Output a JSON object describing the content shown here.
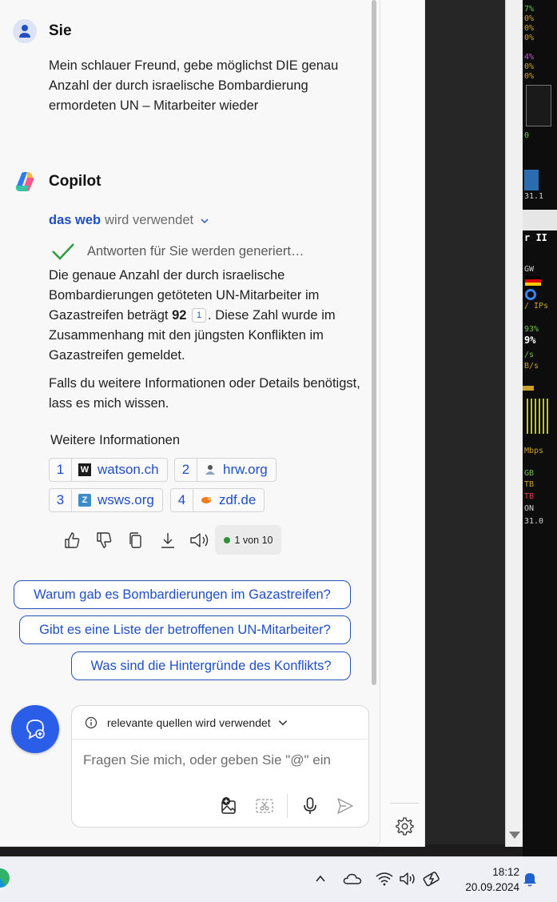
{
  "user": {
    "name": "Sie",
    "message": "Mein schlauer Freund, gebe möglichst DIE genau Anzahl der durch israelische Bombardierung ermordeten UN – Mitarbeiter wieder"
  },
  "copilot": {
    "name": "Copilot",
    "web_link": "das web",
    "web_suffix": "wird verwendet",
    "generating": "Antworten für Sie werden generiert…",
    "answer": {
      "before_number": "Die genaue Anzahl der durch israelische Bombardierungen getöteten UN-Mitarbeiter im Gazastreifen beträgt ",
      "number": "92",
      "citation": "1",
      "after_number": ". Diese Zahl wurde im Zusammenhang mit den jüngsten Konflikten im Gazastreifen gemeldet."
    },
    "followup": "Falls du weitere Informationen oder Details benötigst, lass es mich wissen.",
    "more_info_title": "Weitere Informationen",
    "sources": [
      {
        "num": "1",
        "label": "watson.ch",
        "fav": "W"
      },
      {
        "num": "2",
        "label": "hrw.org",
        "fav": ""
      },
      {
        "num": "3",
        "label": "wsws.org",
        "fav": "Z"
      },
      {
        "num": "4",
        "label": "zdf.de",
        "fav": ""
      }
    ],
    "page_indicator": "1 von 10"
  },
  "suggestions": [
    "Warum gab es Bombardierungen im Gazastreifen?",
    "Gibt es eine Liste der betroffenen UN-Mitarbeiter?",
    "Was sind die Hintergründe des Konflikts?"
  ],
  "composer": {
    "source_mode": "relevante quellen wird verwendet",
    "placeholder": "Fragen Sie mich, oder geben Sie \"@\" ein"
  },
  "widget_text": [
    "7%",
    "0%",
    "0%",
    "0%",
    "4%",
    "0%",
    "0%",
    "0",
    "31.1",
    "r II",
    "GW",
    "/ IPs",
    "93%",
    "9%",
    "/s",
    "B/s",
    "Mbps",
    "GB",
    "TB",
    "TB",
    "ON",
    "31.0"
  ],
  "taskbar": {
    "time": "18:12",
    "date": "20.09.2024"
  },
  "colors": {
    "accent": "#1f4fc4",
    "new_topic": "#2b5ee8",
    "check": "#2f9e44"
  }
}
